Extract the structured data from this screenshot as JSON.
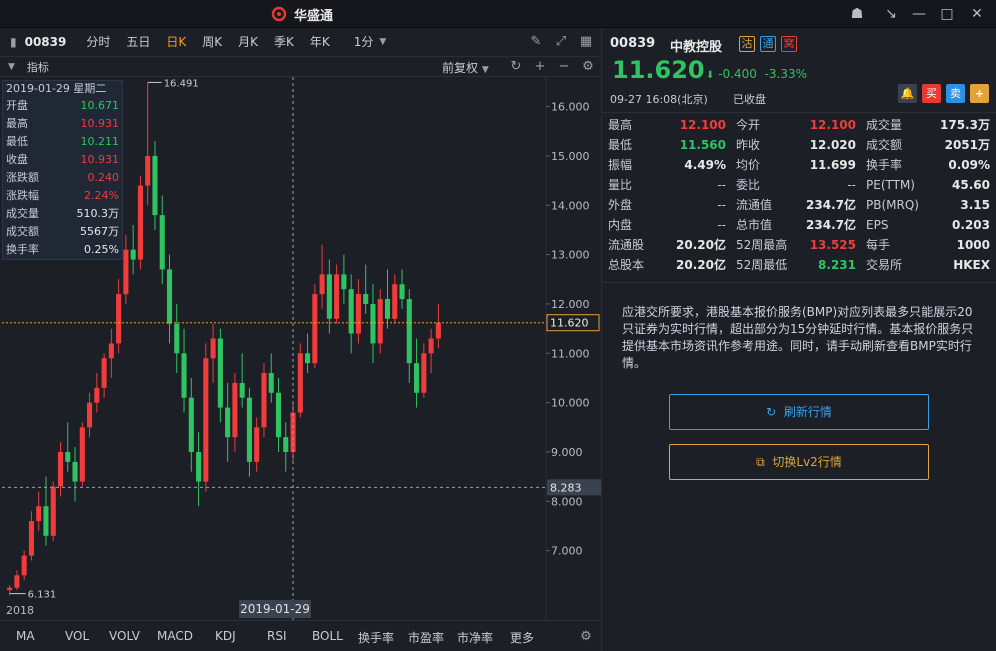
{
  "app": {
    "title": "华盛通"
  },
  "toolbar": {
    "code": "00839",
    "periods": [
      "分时",
      "五日",
      "日K",
      "周K",
      "月K",
      "季K",
      "年K",
      "1分"
    ],
    "active_period": "日K"
  },
  "subbar": {
    "indicator": "指标",
    "fuquan": "前复权"
  },
  "chart_data": {
    "type": "candlestick",
    "y_ticks": [
      "16.000",
      "15.000",
      "14.000",
      "13.000",
      "12.000",
      "11.000",
      "10.000",
      "9.000",
      "8.000",
      "7.000"
    ],
    "ylim": [
      6.0,
      16.6
    ],
    "current_price_line": "11.620",
    "crosshair_price": "8.283",
    "max_label": "16.491",
    "min_label": "6.131",
    "year_label": "2018",
    "crosshair_date": "2019-01-29",
    "candles": [
      [
        6.2,
        6.3,
        6.1,
        6.25
      ],
      [
        6.25,
        6.6,
        6.2,
        6.5
      ],
      [
        6.5,
        7.0,
        6.4,
        6.9
      ],
      [
        6.9,
        7.8,
        6.8,
        7.6
      ],
      [
        7.6,
        8.2,
        7.4,
        7.9
      ],
      [
        7.9,
        8.5,
        7.1,
        7.3
      ],
      [
        7.3,
        8.4,
        7.2,
        8.3
      ],
      [
        8.3,
        9.2,
        8.1,
        9.0
      ],
      [
        9.0,
        9.6,
        8.6,
        8.8
      ],
      [
        8.8,
        9.1,
        8.0,
        8.4
      ],
      [
        8.4,
        9.6,
        8.3,
        9.5
      ],
      [
        9.5,
        10.2,
        9.3,
        10.0
      ],
      [
        10.0,
        10.6,
        9.8,
        10.3
      ],
      [
        10.3,
        11.0,
        10.1,
        10.9
      ],
      [
        10.9,
        11.5,
        10.5,
        11.2
      ],
      [
        11.2,
        12.5,
        11.0,
        12.2
      ],
      [
        12.2,
        13.4,
        12.0,
        13.1
      ],
      [
        13.1,
        13.6,
        12.6,
        12.9
      ],
      [
        12.9,
        14.6,
        12.7,
        14.4
      ],
      [
        14.4,
        16.49,
        14.0,
        15.0
      ],
      [
        15.0,
        15.3,
        13.5,
        13.8
      ],
      [
        13.8,
        14.2,
        12.4,
        12.7
      ],
      [
        12.7,
        13.0,
        11.2,
        11.6
      ],
      [
        11.6,
        12.0,
        10.6,
        11.0
      ],
      [
        11.0,
        11.5,
        9.8,
        10.1
      ],
      [
        10.1,
        10.5,
        8.6,
        9.0
      ],
      [
        9.0,
        9.4,
        7.9,
        8.4
      ],
      [
        8.4,
        11.2,
        8.2,
        10.9
      ],
      [
        10.9,
        11.6,
        10.4,
        11.3
      ],
      [
        11.3,
        11.5,
        9.6,
        9.9
      ],
      [
        9.9,
        10.4,
        8.8,
        9.3
      ],
      [
        9.3,
        10.6,
        9.0,
        10.4
      ],
      [
        10.4,
        11.0,
        9.9,
        10.1
      ],
      [
        10.1,
        10.3,
        8.5,
        8.8
      ],
      [
        8.8,
        9.7,
        8.6,
        9.5
      ],
      [
        9.5,
        10.8,
        9.3,
        10.6
      ],
      [
        10.6,
        11.0,
        10.0,
        10.2
      ],
      [
        10.2,
        10.5,
        9.0,
        9.3
      ],
      [
        9.3,
        9.6,
        8.6,
        9.0
      ],
      [
        9.0,
        10.0,
        8.8,
        9.8
      ],
      [
        9.8,
        11.2,
        9.7,
        11.0
      ],
      [
        11.0,
        11.4,
        10.6,
        10.8
      ],
      [
        10.8,
        12.4,
        10.7,
        12.2
      ],
      [
        12.2,
        13.2,
        11.9,
        12.6
      ],
      [
        12.6,
        12.9,
        11.4,
        11.7
      ],
      [
        11.7,
        12.8,
        11.6,
        12.6
      ],
      [
        12.6,
        13.0,
        12.0,
        12.3
      ],
      [
        12.3,
        12.6,
        11.0,
        11.4
      ],
      [
        11.4,
        12.5,
        11.2,
        12.2
      ],
      [
        12.2,
        12.8,
        11.8,
        12.0
      ],
      [
        12.0,
        12.4,
        10.8,
        11.2
      ],
      [
        11.2,
        12.3,
        11.0,
        12.1
      ],
      [
        12.1,
        12.7,
        11.5,
        11.7
      ],
      [
        11.7,
        12.6,
        11.6,
        12.4
      ],
      [
        12.4,
        12.7,
        11.9,
        12.1
      ],
      [
        12.1,
        12.3,
        10.4,
        10.8
      ],
      [
        10.8,
        11.3,
        9.9,
        10.2
      ],
      [
        10.2,
        11.2,
        10.1,
        11.0
      ],
      [
        11.0,
        11.5,
        10.6,
        11.3
      ],
      [
        11.3,
        12.0,
        11.1,
        11.62
      ]
    ]
  },
  "infobox": {
    "date": "2019-01-29 星期二",
    "rows": [
      {
        "k": "开盘",
        "v": "10.671",
        "c": "green"
      },
      {
        "k": "最高",
        "v": "10.931",
        "c": "red"
      },
      {
        "k": "最低",
        "v": "10.211",
        "c": "green"
      },
      {
        "k": "收盘",
        "v": "10.931",
        "c": "red"
      },
      {
        "k": "涨跌额",
        "v": "0.240",
        "c": "red"
      },
      {
        "k": "涨跌幅",
        "v": "2.24%",
        "c": "red"
      },
      {
        "k": "成交量",
        "v": "510.3万",
        "c": "white"
      },
      {
        "k": "成交额",
        "v": "5567万",
        "c": "white"
      },
      {
        "k": "换手率",
        "v": "0.25%",
        "c": "white"
      }
    ]
  },
  "indicators": [
    "MA",
    "VOL",
    "VOLV",
    "MACD",
    "KDJ",
    "RSI",
    "BOLL",
    "换手率",
    "市盈率",
    "市净率",
    "更多"
  ],
  "quote": {
    "code": "00839",
    "name": "中教控股",
    "badges": [
      "沽",
      "通",
      "窝"
    ],
    "price": "11.620",
    "change": "-0.400",
    "change_pct": "-3.33%",
    "time": "09-27  16:08(北京)",
    "status": "已收盘",
    "actions": [
      "买",
      "卖",
      "+"
    ],
    "grid": [
      [
        {
          "k": "最高",
          "v": "12.100",
          "c": "red"
        },
        {
          "k": "今开",
          "v": "12.100",
          "c": "red"
        },
        {
          "k": "成交量",
          "v": "175.3万",
          "c": "white"
        }
      ],
      [
        {
          "k": "最低",
          "v": "11.560",
          "c": "green"
        },
        {
          "k": "昨收",
          "v": "12.020",
          "c": "white"
        },
        {
          "k": "成交额",
          "v": "2051万",
          "c": "white"
        }
      ],
      [
        {
          "k": "振幅",
          "v": "4.49%",
          "c": "white"
        },
        {
          "k": "均价",
          "v": "11.699",
          "c": "white"
        },
        {
          "k": "换手率",
          "v": "0.09%",
          "c": "white"
        }
      ],
      [
        {
          "k": "量比",
          "v": "--",
          "c": "dim"
        },
        {
          "k": "委比",
          "v": "--",
          "c": "dim"
        },
        {
          "k": "PE(TTM)",
          "v": "45.60",
          "c": "white"
        }
      ],
      [
        {
          "k": "外盘",
          "v": "--",
          "c": "dim"
        },
        {
          "k": "流通值",
          "v": "234.7亿",
          "c": "white"
        },
        {
          "k": "PB(MRQ)",
          "v": "3.15",
          "c": "white"
        }
      ],
      [
        {
          "k": "内盘",
          "v": "--",
          "c": "dim"
        },
        {
          "k": "总市值",
          "v": "234.7亿",
          "c": "white"
        },
        {
          "k": "EPS",
          "v": "0.203",
          "c": "white"
        }
      ],
      [
        {
          "k": "流通股",
          "v": "20.20亿",
          "c": "white"
        },
        {
          "k": "52周最高",
          "v": "13.525",
          "c": "red"
        },
        {
          "k": "每手",
          "v": "1000",
          "c": "white"
        }
      ],
      [
        {
          "k": "总股本",
          "v": "20.20亿",
          "c": "white"
        },
        {
          "k": "52周最低",
          "v": "8.231",
          "c": "green"
        },
        {
          "k": "交易所",
          "v": "HKEX",
          "c": "white"
        }
      ]
    ],
    "notice": "应港交所要求，港股基本报价服务(BMP)对应列表最多只能展示20只证券为实时行情，超出部分为15分钟延时行情。基本报价服务只提供基本市场资讯作参考用途。同时，请手动刷新查看BMP实时行情。",
    "refresh_label": "刷新行情",
    "lv2_label": "切换Lv2行情"
  },
  "colors": {
    "up": "#f23b3b",
    "down": "#2fc461",
    "accent": "#ff9c1a",
    "blue": "#3aa0e8"
  }
}
